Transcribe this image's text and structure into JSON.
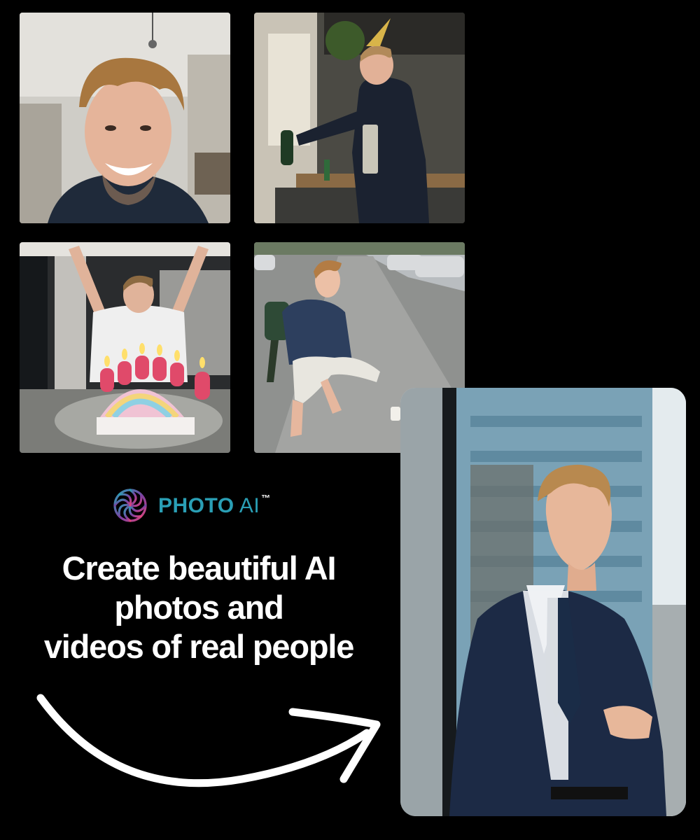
{
  "brand": {
    "name_strong": "PHOTO",
    "name_light": " AI",
    "trademark": "™",
    "icon": "spiral-logo-icon",
    "colors": {
      "teal": "#2a9fb5",
      "purple": "#7b3fa0",
      "pink": "#e0457b"
    }
  },
  "headline": {
    "line1": "Create beautiful AI",
    "line2": "photos and",
    "line3": "videos of real people"
  },
  "photos": [
    {
      "icon": "selfie-photo"
    },
    {
      "icon": "party-photo"
    },
    {
      "icon": "birthday-cake-photo"
    },
    {
      "icon": "street-crouch-photo"
    },
    {
      "icon": "ai-business-portrait-photo"
    }
  ],
  "arrow": {
    "icon": "curved-arrow-icon",
    "color": "#ffffff"
  }
}
